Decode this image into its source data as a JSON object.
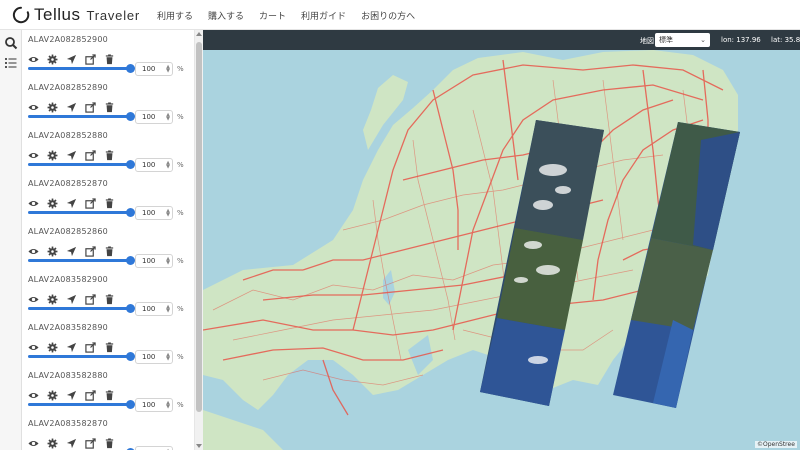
{
  "header": {
    "logo_text": "Tellus",
    "logo_sub": "Traveler",
    "nav": [
      "利用する",
      "購入する",
      "カート",
      "利用ガイド",
      "お困りの方へ"
    ]
  },
  "layers": [
    {
      "name": "ALAV2A082852900",
      "opacity": "100"
    },
    {
      "name": "ALAV2A082852890",
      "opacity": "100"
    },
    {
      "name": "ALAV2A082852880",
      "opacity": "100"
    },
    {
      "name": "ALAV2A082852870",
      "opacity": "100"
    },
    {
      "name": "ALAV2A082852860",
      "opacity": "100"
    },
    {
      "name": "ALAV2A083582900",
      "opacity": "100"
    },
    {
      "name": "ALAV2A083582890",
      "opacity": "100"
    },
    {
      "name": "ALAV2A083582880",
      "opacity": "100"
    },
    {
      "name": "ALAV2A083582870",
      "opacity": "100"
    }
  ],
  "percent_unit": "%",
  "map": {
    "basemap_label": "地図",
    "basemap_value": "標準",
    "lon_text": "lon: 137.96",
    "lat_text": "lat: 35.8",
    "attribution": "©OpenStree"
  },
  "colors": {
    "accent": "#2f78d8",
    "mapbar": "#2f3a42",
    "water": "#aad3df",
    "land": "#cfe5c4",
    "road": "#e8564a"
  },
  "icons": [
    "eye-icon",
    "gear-icon",
    "locate-arrow-icon",
    "export-icon",
    "trash-icon",
    "search-icon",
    "layers-list-icon"
  ]
}
